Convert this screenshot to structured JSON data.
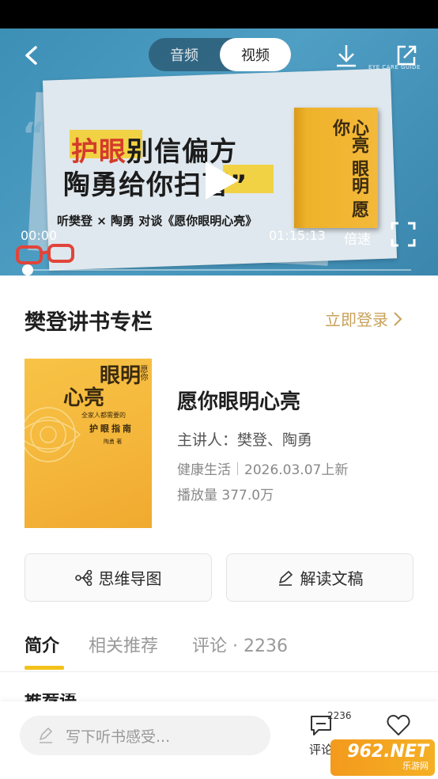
{
  "video": {
    "tabs": [
      "音频",
      "视频"
    ],
    "active_tab": "视频",
    "eye_care_badge": "EYE CARE GUIDE",
    "poster_headline_red": "护眼",
    "poster_headline_rest": "别信偏方",
    "poster_headline2": "陶勇给你扫盲”",
    "poster_subline": "听樊登 × 陶勇 对谈《愿你眼明心亮》",
    "poster_book_title": "心亮 眼明 愿你",
    "time_current": "00:00",
    "time_total": "01:15:13",
    "speed_label": "倍速",
    "progress": 0.0,
    "icons": [
      "back-icon",
      "download-icon",
      "share-icon",
      "play-icon",
      "fullscreen-icon"
    ]
  },
  "column": {
    "title": "樊登讲书专栏",
    "login_label": "立即登录"
  },
  "book": {
    "cover_title_line1": "眼明",
    "cover_title_line2": "心亮",
    "cover_prefix": "愿你",
    "cover_subtitle": "全家人都需要的",
    "cover_subtitle2": "护眼指南",
    "cover_author": "陶勇 著",
    "title": "愿你眼明心亮",
    "speaker": "主讲人：樊登、陶勇",
    "category": "健康生活",
    "date": "2026.03.07上新",
    "plays": "播放量 377.0万"
  },
  "actions": {
    "mindmap_label": "思维导图",
    "transcript_label": "解读文稿"
  },
  "tabs": {
    "intro": "简介",
    "related": "相关推荐",
    "comments": "评论 · 2236"
  },
  "peek_text": "推荐语",
  "bottom": {
    "input_placeholder": "写下听书感受...",
    "comment_count": "2236",
    "comment_label": "评论"
  },
  "watermark": {
    "line1": "962.NET",
    "line2": "乐游网"
  },
  "colors": {
    "accent_yellow": "#f3c21a",
    "login_gold": "#c9a25a",
    "video_blue": "#4f9ec4"
  }
}
